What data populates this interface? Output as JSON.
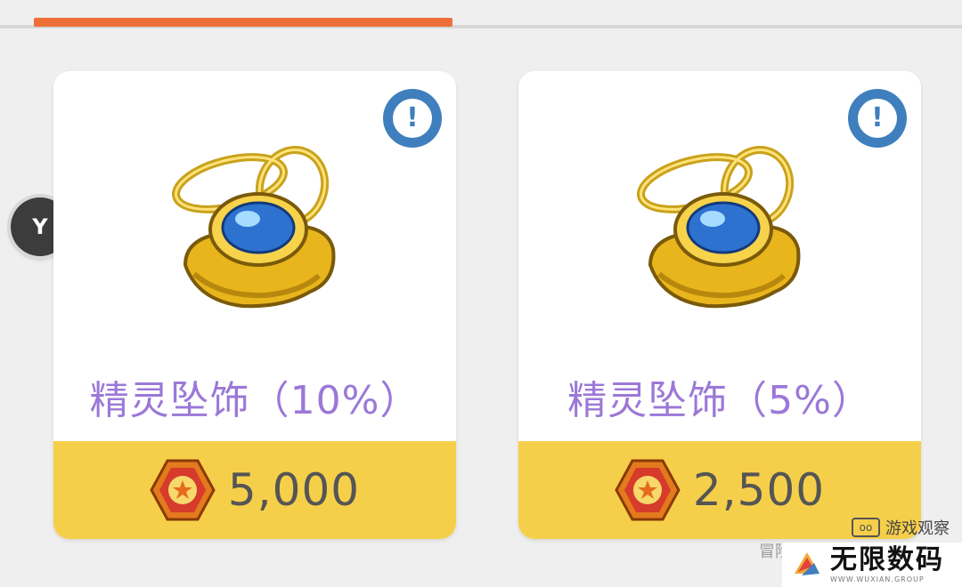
{
  "side_badge": {
    "label": "Y"
  },
  "items": [
    {
      "name": "精灵坠饰（10%）",
      "price": "5,000",
      "info_icon": "info-alarm-icon",
      "coin_icon": "star-coin-icon"
    },
    {
      "name": "精灵坠饰（5%）",
      "price": "2,500",
      "info_icon": "info-alarm-icon",
      "coin_icon": "star-coin-icon"
    }
  ],
  "watermarks": {
    "top_text": "游戏观察",
    "faded_text": "冒险岛手游",
    "brand_name": "无限数码",
    "brand_sub": "WWW.WUXIAN.GROUP"
  },
  "colors": {
    "tab_indicator": "#ee6f37",
    "item_name": "#9b78d8",
    "price_bar": "#f6cf4a",
    "info_icon": "#3f7fbd"
  }
}
